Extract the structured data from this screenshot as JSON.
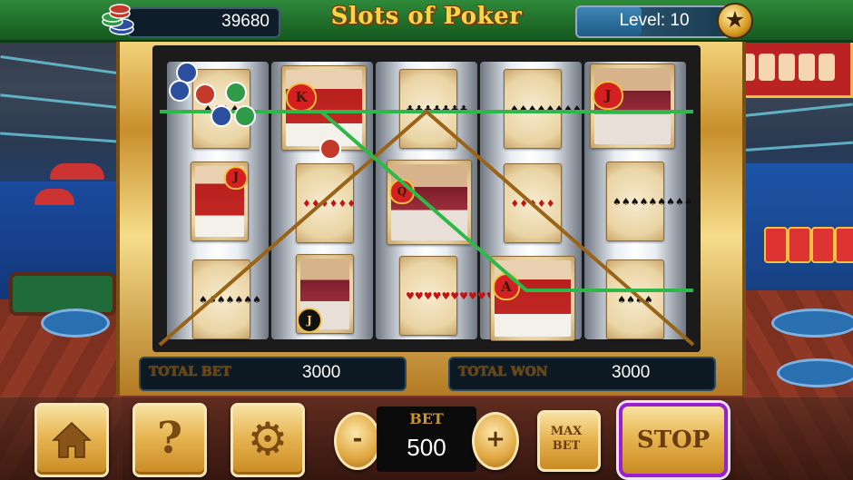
{
  "header": {
    "title": "Slots of Poker",
    "coins": "39680",
    "level_label": "Level: 10",
    "level_progress": 0.42
  },
  "info": {
    "total_bet_label": "TOTAL BET",
    "total_bet_value": "3000",
    "total_won_label": "TOTAL WON",
    "total_won_value": "3000"
  },
  "controls": {
    "bet_label": "BET",
    "bet_value": "500",
    "minus_label": "-",
    "plus_label": "+",
    "max_bet_label": "MAX\nBET",
    "stop_label": "STOP",
    "help_label": "?"
  },
  "reels": {
    "card_ranks": [
      "K",
      "J",
      "J",
      "J",
      "A",
      "J"
    ]
  },
  "colors": {
    "payline_green": "#2fb84a",
    "payline_brown": "#9a6418",
    "stop_border": "#9a1fd0",
    "title_gold": "#f7d64a"
  },
  "icons": [
    "chips-icon",
    "star-icon",
    "home-icon",
    "help-icon",
    "gear-icon"
  ]
}
